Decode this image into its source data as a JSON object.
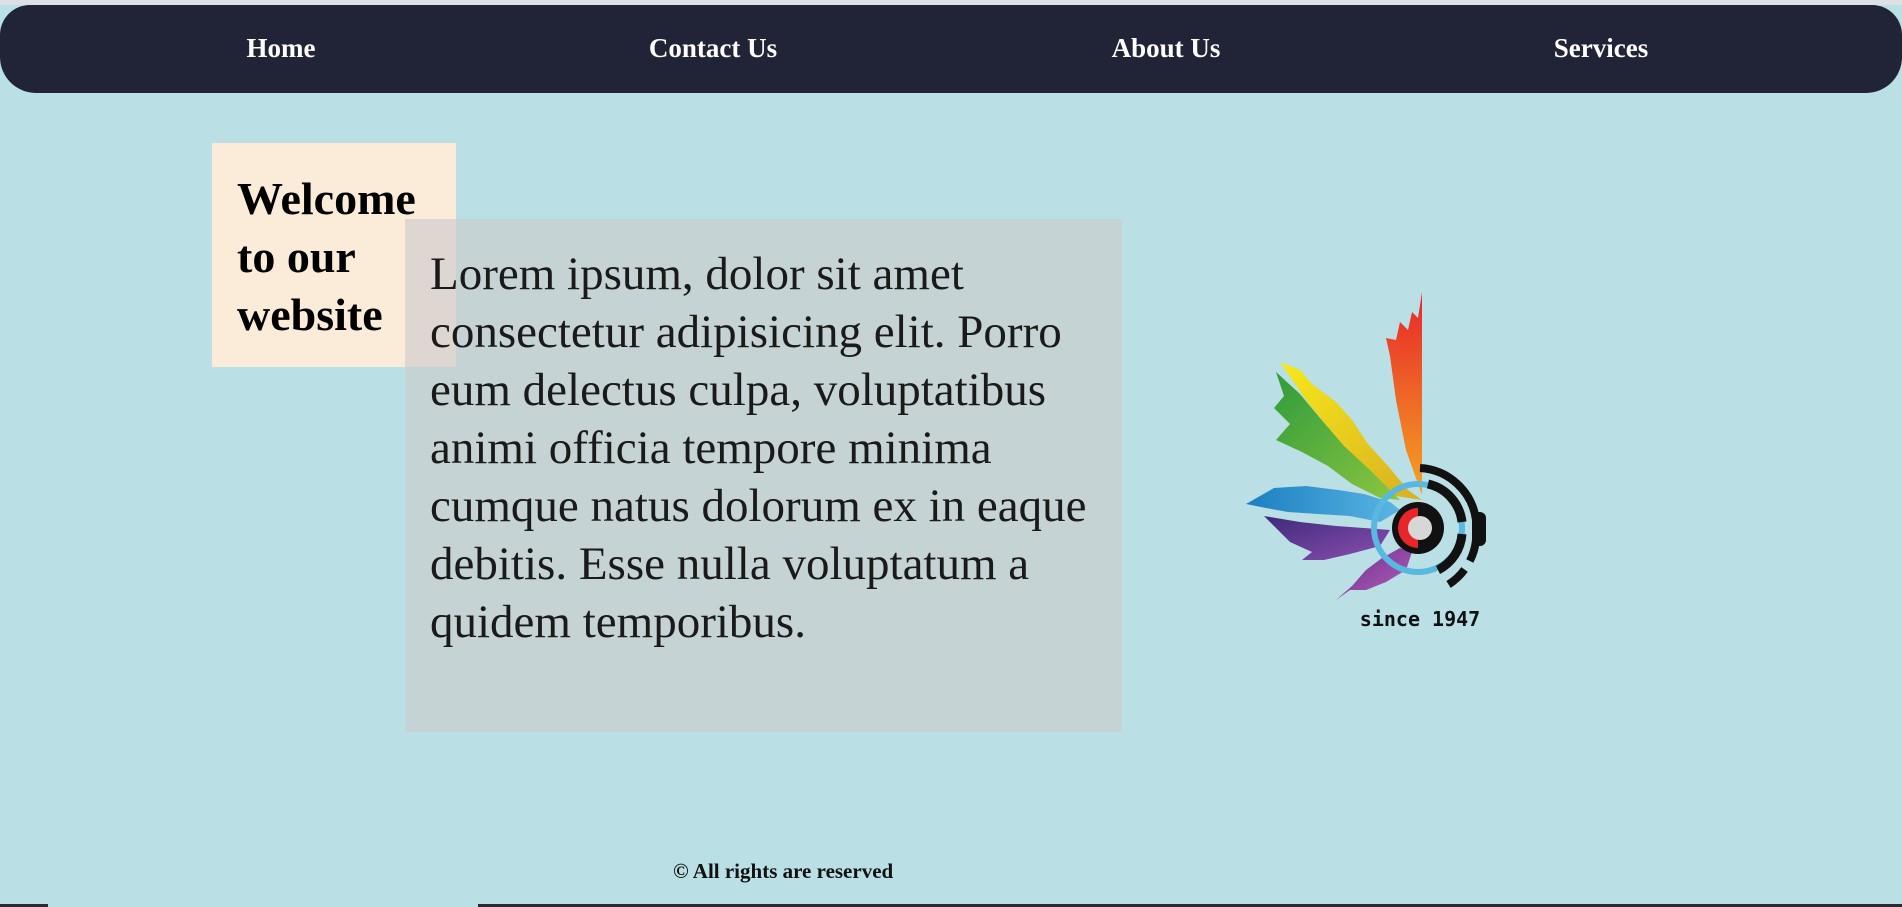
{
  "nav": {
    "items": [
      {
        "label": "Home"
      },
      {
        "label": "Contact Us"
      },
      {
        "label": "About Us"
      },
      {
        "label": "Services"
      }
    ]
  },
  "hero": {
    "welcome_title": "Welcome to our website",
    "lorem": "Lorem ipsum, dolor sit amet consectetur adipisicing elit. Porro eum delectus culpa, voluptatibus animi officia tempore minima cumque natus dolorum ex in eaque debitis. Esse nulla voluptatum a quidem temporibus."
  },
  "logo": {
    "icon": "rainbow-feather-headphone-logo",
    "caption": "since 1947"
  },
  "footer": {
    "text": "© All rights are reserved"
  },
  "colors": {
    "background": "#badfe5",
    "navbar": "#212337",
    "welcome_box": "#fbebd9",
    "lorem_box": "#c2cfd4"
  }
}
